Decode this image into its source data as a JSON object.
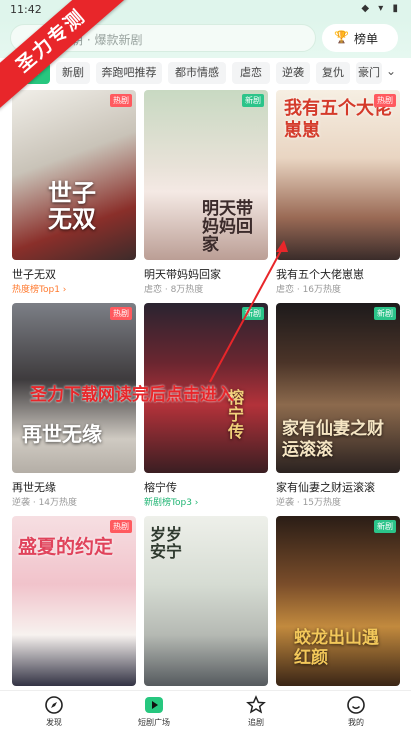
{
  "status": {
    "time": "11:42",
    "icons": "◆ ▾ ▮"
  },
  "search": {
    "placeholder": "今朝 · 爆款新剧"
  },
  "rank_button": {
    "label": "榜单"
  },
  "categories": [
    "推荐",
    "新剧",
    "奔跑吧推荐",
    "都市情感",
    "虐恋",
    "逆袭",
    "复仇",
    "豪门"
  ],
  "more_icon": "chevron-down-icon",
  "watermark": {
    "banner": "圣力专测",
    "overlay": "圣力下载网读完后点击进入"
  },
  "cards": [
    {
      "title": "世子无双",
      "meta": "热度榜Top1 ›",
      "meta_type": "rank",
      "badge": "热剧",
      "badge_type": "hot",
      "poster_text": "世子无双"
    },
    {
      "title": "明天带妈妈回家",
      "meta": "虐恋 · 8万热度",
      "meta_type": "plain",
      "badge": "新剧",
      "badge_type": "new",
      "poster_text": "明天带妈妈回家"
    },
    {
      "title": "我有五个大佬崽崽",
      "meta": "虐恋 · 16万热度",
      "meta_type": "plain",
      "badge": "热剧",
      "badge_type": "hot",
      "poster_text": "我有五个大佬崽崽"
    },
    {
      "title": "再世无缘",
      "meta": "逆袭 · 14万热度",
      "meta_type": "plain",
      "badge": "热剧",
      "badge_type": "hot",
      "poster_text": "再世无缘"
    },
    {
      "title": "榕宁传",
      "meta": "新剧榜Top3 ›",
      "meta_type": "rank-green",
      "badge": "新剧",
      "badge_type": "new",
      "poster_text": "榕宁传"
    },
    {
      "title": "家有仙妻之财运滚滚",
      "meta": "逆袭 · 15万热度",
      "meta_type": "plain",
      "badge": "新剧",
      "badge_type": "new",
      "poster_text": "家有仙妻之财运滚滚"
    },
    {
      "title": "",
      "meta": "",
      "meta_type": "plain",
      "badge": "热剧",
      "badge_type": "hot",
      "poster_text": "盛夏的约定"
    },
    {
      "title": "",
      "meta": "",
      "meta_type": "plain",
      "badge": "",
      "badge_type": "hot",
      "poster_text": "岁岁安宁"
    },
    {
      "title": "",
      "meta": "",
      "meta_type": "plain",
      "badge": "新剧",
      "badge_type": "new",
      "poster_text": "蛟龙出山遇红颜"
    }
  ],
  "tabs": [
    {
      "label": "发现",
      "icon": "compass-icon"
    },
    {
      "label": "短剧广场",
      "icon": "play-icon"
    },
    {
      "label": "追剧",
      "icon": "star-icon"
    },
    {
      "label": "我的",
      "icon": "smile-icon"
    }
  ],
  "colors": {
    "accent": "#27c77f",
    "hot": "#ff5a5f",
    "new": "#2bc48a",
    "watermark": "#e8262a"
  }
}
